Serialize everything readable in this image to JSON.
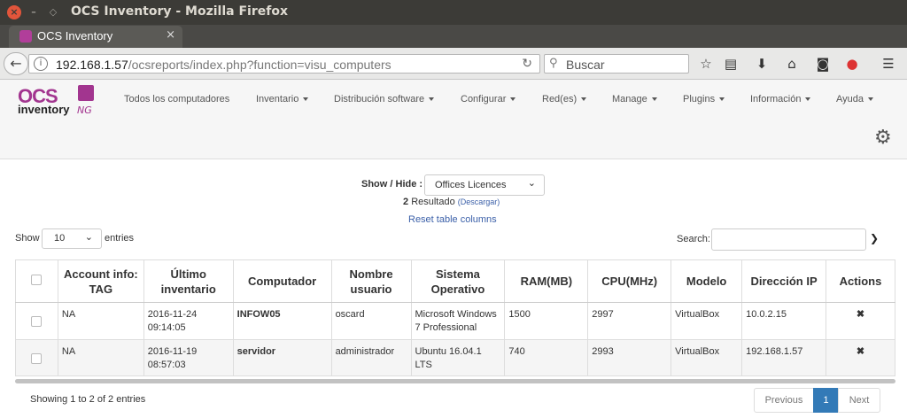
{
  "window": {
    "title": "OCS Inventory - Mozilla Firefox"
  },
  "browser": {
    "tab_title": "OCS Inventory",
    "url_host": "192.168.1.57",
    "url_path": "/ocsreports/index.php?function=visu_computers",
    "search_placeholder": "Buscar"
  },
  "logo": {
    "top": "OCS",
    "bottom": "inventory",
    "ng": "NG"
  },
  "nav": {
    "items": [
      {
        "label": "Todos los computadores"
      },
      {
        "label": "Inventario"
      },
      {
        "label": "Distribución software"
      },
      {
        "label": "Configurar"
      },
      {
        "label": "Red(es)"
      },
      {
        "label": "Manage"
      },
      {
        "label": "Plugins"
      },
      {
        "label": "Información"
      },
      {
        "label": "Ayuda"
      }
    ]
  },
  "controls": {
    "show_hide_label": "Show / Hide :",
    "show_hide_value": "Offices Licences",
    "result_count": "2",
    "result_word": "Resultado",
    "download_link": "(Descargar)",
    "reset_columns": "Reset table columns",
    "show_label": "Show",
    "entries_value": "10",
    "entries_label": "entries",
    "search_label": "Search:",
    "search_value": ""
  },
  "table": {
    "headers": [
      "Account info: TAG",
      "Último inventario",
      "Computador",
      "Nombre usuario",
      "Sistema Operativo",
      "RAM(MB)",
      "CPU(MHz)",
      "Modelo",
      "Dirección IP",
      "Actions"
    ],
    "rows": [
      {
        "tag": "NA",
        "date": "2016-11-24",
        "time": "09:14:05",
        "computer": "INFOW05",
        "user": "oscard",
        "os1": "Microsoft Windows",
        "os2": "7 Professional",
        "ram": "1500",
        "cpu": "2997",
        "model": "VirtualBox",
        "ip": "10.0.2.15"
      },
      {
        "tag": "NA",
        "date": "2016-11-19",
        "time": "08:57:03",
        "computer": "servidor",
        "user": "administrador",
        "os1": "Ubuntu 16.04.1",
        "os2": "LTS",
        "ram": "740",
        "cpu": "2993",
        "model": "VirtualBox",
        "ip": "192.168.1.57"
      }
    ]
  },
  "footer": {
    "showing": "Showing 1 to 2 of 2 entries",
    "previous": "Previous",
    "page": "1",
    "next": "Next"
  },
  "colors": {
    "brand": "#a2358f",
    "link": "#3a5fa8",
    "pager_active": "#337ab7"
  }
}
